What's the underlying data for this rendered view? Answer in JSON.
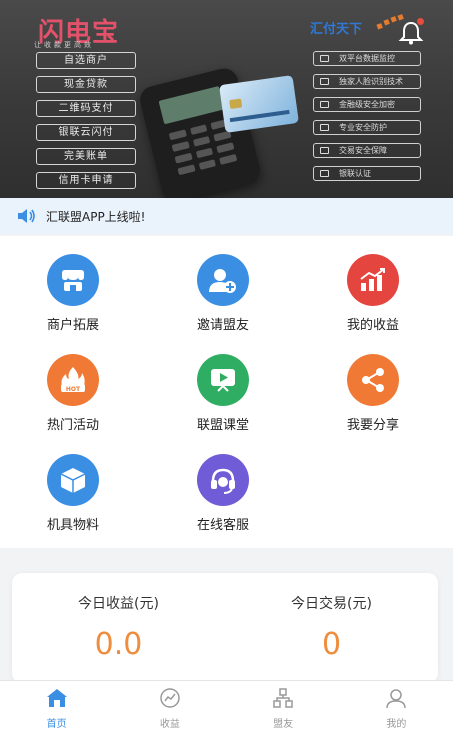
{
  "banner": {
    "logo": "闪电宝",
    "logo_sub": "让收款更高效",
    "left_pills": [
      "自选商户",
      "现金贷款",
      "二维码支付",
      "银联云闪付",
      "完美账单",
      "信用卡申请"
    ],
    "brand": "汇付天下",
    "right_pills": [
      "双平台数据监控",
      "独家人脸识别技术",
      "金融级安全加密",
      "专业安全防护",
      "交易安全保障",
      "银联认证"
    ]
  },
  "notice": {
    "text": "汇联盟APP上线啦!"
  },
  "menu": {
    "items": [
      {
        "label": "商户拓展",
        "icon": "shop-icon",
        "color": "#3a8fe3"
      },
      {
        "label": "邀请盟友",
        "icon": "add-user-icon",
        "color": "#3a8fe3"
      },
      {
        "label": "我的收益",
        "icon": "growth-chart-icon",
        "color": "#e4453f"
      },
      {
        "label": "热门活动",
        "icon": "hot-fire-icon",
        "color": "#f07a35"
      },
      {
        "label": "联盟课堂",
        "icon": "video-class-icon",
        "color": "#2fae63"
      },
      {
        "label": "我要分享",
        "icon": "share-icon",
        "color": "#f07a35"
      },
      {
        "label": "机具物料",
        "icon": "box-icon",
        "color": "#3a8fe3"
      },
      {
        "label": "在线客服",
        "icon": "headset-icon",
        "color": "#6f5cd6"
      }
    ]
  },
  "stats": {
    "income_title": "今日收益(元)",
    "income_value": "0.0",
    "trade_title": "今日交易(元)",
    "trade_value": "0"
  },
  "tabbar": {
    "tabs": [
      {
        "label": "首页",
        "icon": "home-icon",
        "active": true
      },
      {
        "label": "收益",
        "icon": "chart-icon",
        "active": false
      },
      {
        "label": "盟友",
        "icon": "network-icon",
        "active": false
      },
      {
        "label": "我的",
        "icon": "user-icon",
        "active": false
      }
    ]
  },
  "colors": {
    "accent": "#3a8fe3",
    "value": "#ee8d3e"
  }
}
